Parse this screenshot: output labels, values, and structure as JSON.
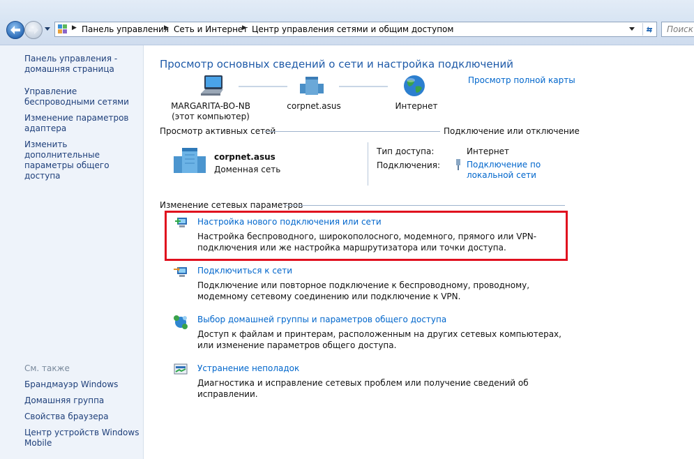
{
  "addressbar": {
    "crumbs": [
      "Панель управления",
      "Сеть и Интернет",
      "Центр управления сетями и общим доступом"
    ],
    "search_placeholder": "Поиск в"
  },
  "sidebar": {
    "items": [
      {
        "label": "Панель управления - домашняя страница"
      },
      {
        "label": "Управление беспроводными сетями"
      },
      {
        "label": "Изменение параметров адаптера"
      },
      {
        "label": "Изменить дополнительные параметры общего доступа"
      }
    ],
    "see_also_title": "См. также",
    "see_also": [
      {
        "label": "Брандмауэр Windows"
      },
      {
        "label": "Домашняя группа"
      },
      {
        "label": "Свойства браузера"
      },
      {
        "label": "Центр устройств Windows Mobile"
      }
    ]
  },
  "main": {
    "title": "Просмотр основных сведений о сети и настройка подключений",
    "full_map_link": "Просмотр полной карты",
    "map": {
      "computer_name": "MARGARITA-BO-NB",
      "computer_sub": "(этот компьютер)",
      "network": "corpnet.asus",
      "internet": "Интернет"
    },
    "active": {
      "heading": "Просмотр активных сетей",
      "connect_link": "Подключение или отключение",
      "network_name": "corpnet.asus",
      "network_type": "Доменная сеть",
      "access_type_label": "Тип доступа:",
      "access_type_value": "Интернет",
      "connections_label": "Подключения:",
      "connections_value": "Подключение по локальной сети"
    },
    "change": {
      "heading": "Изменение сетевых параметров",
      "tasks": [
        {
          "link": "Настройка нового подключения или сети",
          "desc": "Настройка беспроводного, широкополосного, модемного, прямого или VPN-подключения или же настройка маршрутизатора или точки доступа."
        },
        {
          "link": "Подключиться к сети",
          "desc": "Подключение или повторное подключение к беспроводному, проводному, модемному сетевому соединению или подключение к VPN."
        },
        {
          "link": "Выбор домашней группы и параметров общего доступа",
          "desc": "Доступ к файлам и принтерам, расположенным на других сетевых компьютерах, или изменение параметров общего доступа."
        },
        {
          "link": "Устранение неполадок",
          "desc": "Диагностика и исправление сетевых проблем или получение сведений об исправлении."
        }
      ]
    }
  },
  "colors": {
    "link": "#0066cc",
    "title": "#1e5aa8",
    "highlight": "#e0101e",
    "sidebar_bg": "#eef3fa"
  }
}
